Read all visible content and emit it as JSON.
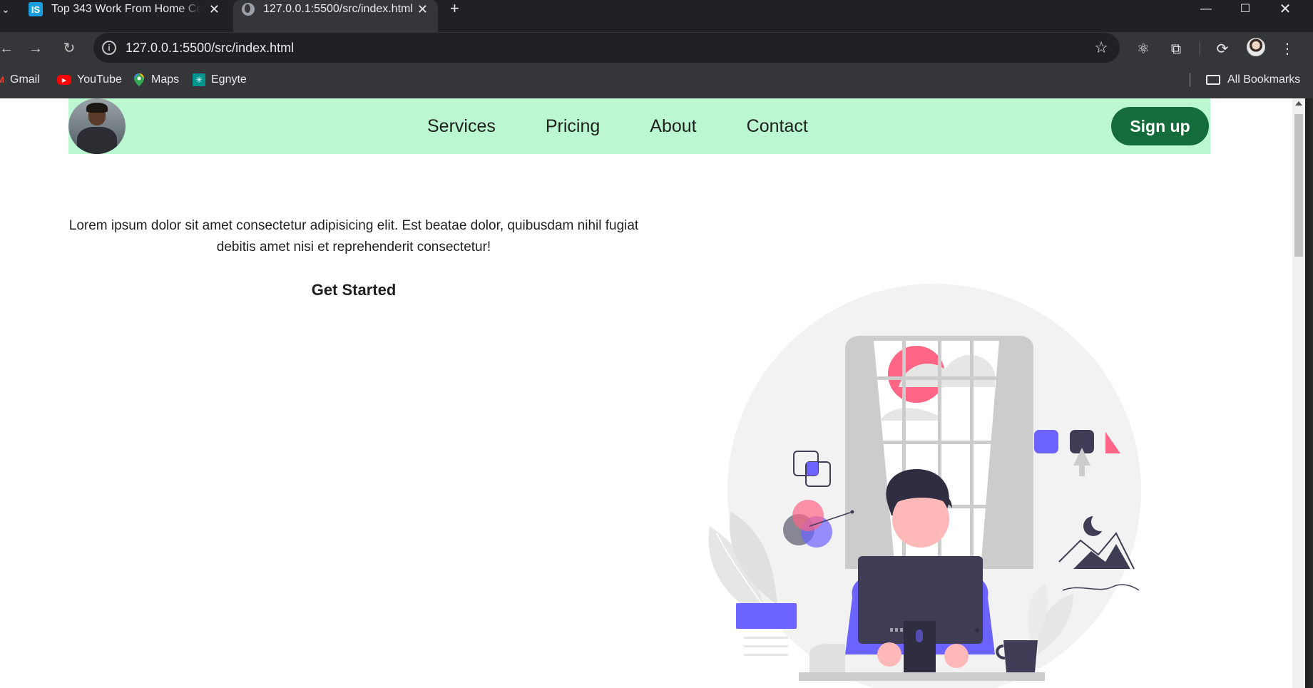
{
  "browser": {
    "tabs": [
      {
        "title": "Top 343 Work From Home Com",
        "favicon": "IS"
      },
      {
        "title": "127.0.0.1:5500/src/index.html",
        "favicon": "globe-icon"
      }
    ],
    "url": "127.0.0.1:5500/src/index.html",
    "bookmarks": [
      {
        "label": "Gmail",
        "icon": "gmail-icon"
      },
      {
        "label": "YouTube",
        "icon": "youtube-icon"
      },
      {
        "label": "Maps",
        "icon": "maps-icon"
      },
      {
        "label": "Egnyte",
        "icon": "egnyte-icon"
      }
    ],
    "all_bookmarks": "All Bookmarks"
  },
  "site": {
    "nav": {
      "links": [
        "Services",
        "Pricing",
        "About",
        "Contact"
      ],
      "signup_label": "Sign up"
    },
    "hero": {
      "text": "Lorem ipsum dolor sit amet consectetur adipisicing elit. Est beatae dolor, quibusdam nihil fugiat debitis amet nisi et reprehenderit consectetur!",
      "cta": "Get Started"
    },
    "colors": {
      "nav_bg": "#bbf7d0",
      "signup_bg": "#146c3a",
      "illustration_accent": "#6c63ff",
      "illustration_pink": "#ff6584",
      "illustration_dark": "#3f3d56"
    }
  }
}
